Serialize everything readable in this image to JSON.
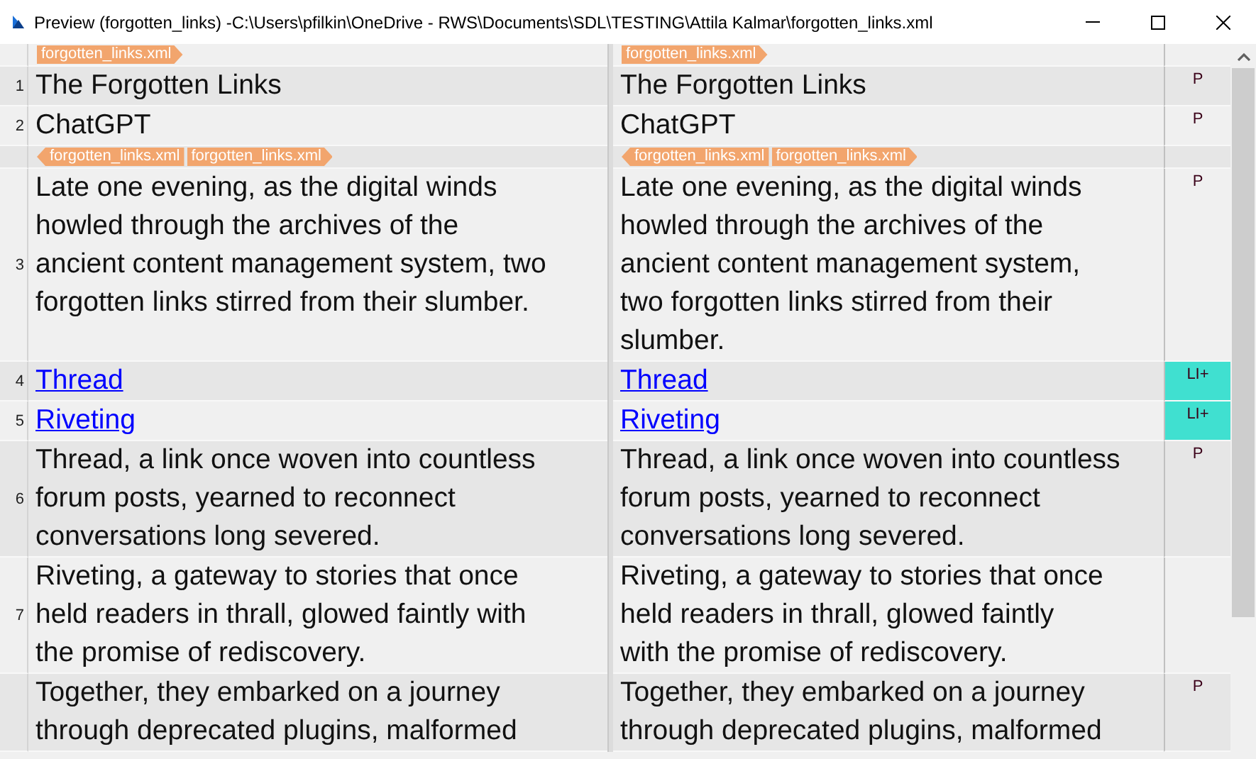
{
  "window": {
    "title": "Preview (forgotten_links) -C:\\Users\\pfilkin\\OneDrive - RWS\\Documents\\SDL\\TESTING\\Attila Kalmar\\forgotten_links.xml"
  },
  "rows": [
    {
      "kind": "tags",
      "source_tags": [
        {
          "label": "forgotten_links.xml",
          "kind": "start"
        }
      ],
      "target_tags": [
        {
          "label": "forgotten_links.xml",
          "kind": "start"
        }
      ]
    },
    {
      "kind": "segment",
      "number": "1",
      "style": "P",
      "highlighted": false,
      "source": [
        "The Forgotten Links"
      ],
      "target": [
        "The Forgotten Links"
      ]
    },
    {
      "kind": "segment",
      "number": "2",
      "style": "P",
      "highlighted": false,
      "source": [
        "ChatGPT"
      ],
      "target": [
        "ChatGPT"
      ]
    },
    {
      "kind": "tags",
      "source_tags": [
        {
          "label": "forgotten_links.xml",
          "kind": "end"
        },
        {
          "label": "forgotten_links.xml",
          "kind": "start"
        }
      ],
      "target_tags": [
        {
          "label": "forgotten_links.xml",
          "kind": "end"
        },
        {
          "label": "forgotten_links.xml",
          "kind": "start"
        }
      ]
    },
    {
      "kind": "segment",
      "number": "3",
      "style": "P",
      "highlighted": false,
      "source": [
        "Late one evening, as the digital winds",
        "howled through the archives of the",
        "ancient content management system, two",
        "forgotten links stirred from their slumber."
      ],
      "target": [
        "Late one evening, as the digital winds",
        "howled through the archives of the",
        "ancient content management system,",
        "two forgotten links stirred from their",
        "slumber."
      ]
    },
    {
      "kind": "link_segment",
      "number": "4",
      "style": "LI+",
      "highlighted": true,
      "source": [
        "Thread"
      ],
      "target": [
        "Thread"
      ]
    },
    {
      "kind": "link_segment",
      "number": "5",
      "style": "LI+",
      "highlighted": true,
      "source": [
        "Riveting"
      ],
      "target": [
        "Riveting"
      ]
    },
    {
      "kind": "segment",
      "number": "6",
      "style": "P",
      "highlighted": false,
      "source": [
        "Thread, a link once woven into countless",
        "forum posts, yearned to reconnect",
        "conversations long severed."
      ],
      "target": [
        "Thread, a link once woven into countless",
        "forum posts, yearned to reconnect",
        "conversations long severed."
      ]
    },
    {
      "kind": "segment",
      "number": "7",
      "highlighted": false,
      "source": [
        "Riveting, a gateway to stories that once",
        "held readers in thrall, glowed faintly with",
        "the promise of rediscovery."
      ],
      "target": [
        "Riveting, a gateway to stories that once",
        "held readers in thrall, glowed faintly",
        "with the promise of rediscovery."
      ]
    },
    {
      "kind": "segment",
      "style": "P",
      "highlighted": false,
      "source": [
        "Together, they embarked on a journey",
        "through deprecated plugins, malformed"
      ],
      "target": [
        "Together, they embarked on a journey",
        "through deprecated plugins, malformed"
      ]
    }
  ]
}
